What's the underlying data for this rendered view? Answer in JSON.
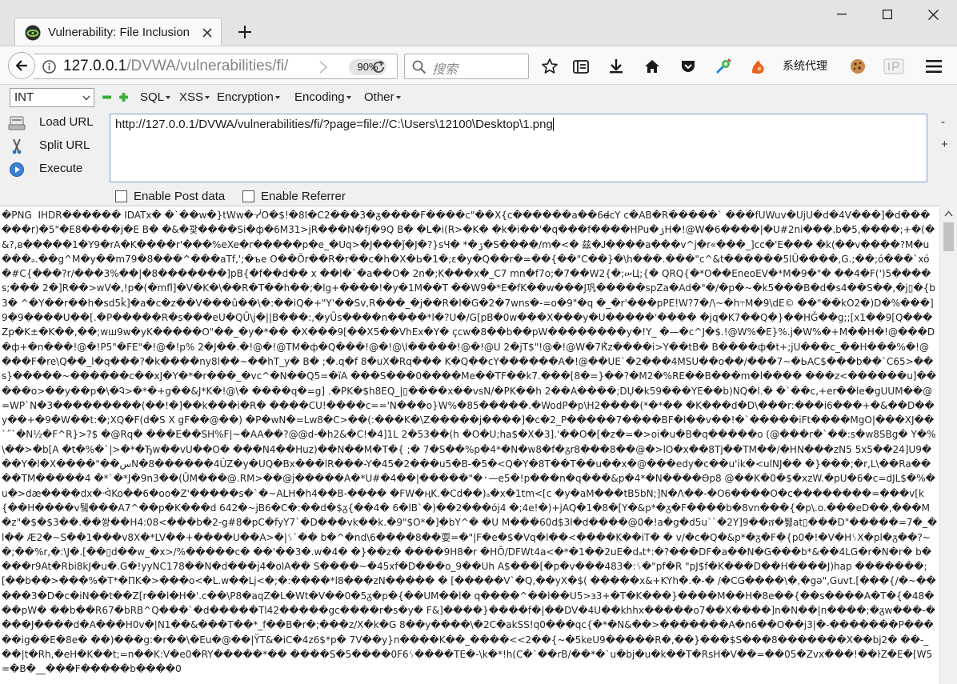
{
  "browser": {
    "tab_title": "Vulnerability: File Inclusion",
    "address": {
      "host": "127.0.0.1",
      "path": "/DVWA/vulnerabilities/fi/"
    },
    "zoom": "90%",
    "search_placeholder": "搜索",
    "proxy_label": "系统代理"
  },
  "hackbar": {
    "type_select": "INT",
    "menus": [
      "SQL",
      "XSS",
      "Encryption",
      "Encoding",
      "Other"
    ],
    "actions": {
      "load": "Load URL",
      "split": "Split URL",
      "execute": "Execute"
    },
    "url_value": "http://127.0.0.1/DVWA/vulnerabilities/fi/?page=file://C:\\Users\\12100\\Desktop\\1.png",
    "side_minus": "-",
    "side_plus": "+",
    "enable_post": "Enable Post data",
    "enable_referrer": "Enable Referrer"
  },
  "content": {
    "garbled_text": "�PNG  IHDR������ IDATx� �`��w�}tWw�ᓺO�$!�8I�C2���3�ᵹ����F����c\"��X{c������a��6d̶cY c�AB�R�����` ���fUWuv�UjU�d�4V���]�d������r)�5\"�E8����j�E B� �&�쾇����Si�ф�6M31>jR���N�fj�9Q B� �L�i(R>�K� �k�i��'�q���f����HPu�ۯH�!@W�6����|�U#2ni���.b�5,����;+�(�&?,в�����1�Y9�rA�K����r'���%eXe�r�����p�e_�Uq>�J���ǰ�J�?}sЧ� *�ۯ�S����/m�<� 兹�Ꭻ����a���v^j�r«���_]cc�'E��� �k(��v����?M�u���ₔ.��g^M�y��m79�8���^���aTf,';�ъe O��Õr��R�r��c�h�X�Ь�1�;ɛ�y�Q��r�=��{��\"C��}�\\h���.���\"c^&t������5lŪ����,G.;��;ó���`xó�#C{���?r/���3%��|�8�������]pB{�f��d�� x ��l�`�a��O� 2n�;K���x�_C7 mn�f7o;�7��W2{�;ሠЦ;{� QRQ{�*O��EneoEV�*M�9�\"� ��4�F(')5����s;��� 2�]R��>wV�,!p�(�mfl]�V�K�\\��R�T��h��;�lg+����!�y�1M��T ��W9�*E�fK��w���J巩�����spZa�Ad�\"�/�p�~�k5���B�d�s4��S��,�j▯�{b3� ^�Y��r��h�sd5k̃]�a�c�z��V���û��\\�:��iQ�+\"Y'��Sv,R���_�j��R�l�G�2�7wns�-=o�9\"�q �_�r'���pPE!W?7�/\\~�h⥾M�9\\dE© ��\"��kO2�)D�%���]9�9����U��[.�P�����R�s���eU�QŪ\\j�||B���:,�yŪs����n����*l�?U�/G[pB�0w���X���y�U�����'���� �jq�K7��Q�}��HǦ��g;;[x1��9[Q���Zp�K±�K��,��;wш9w�yK�����O\"��_�y�*�� �X���9[��X5��VhEx�Y� ҫcw�8��b��pW��������y�!Y_ �—�c^J�$.!@W%�E}%.j�W%�+M��H�!@���D�ф+�n���!@�!P5\"�FE\"�!@�!p% 2�J��.�!@�!@TM�ф�Q���!@�!@\\l�����!@�!@U 2�jT$\"!@�!@W�7Ќ̆z����i>Y��tB� B����ф�t+;jU���c_��H���%�!@���F�re\\Q��_l�q���?�k����ny8l��~��hT_y� B� ;�.q�f 8�uX�Rq��� K�Q��cY������A�!@��UE`�2���4MSU��o��/���7~�ЬAC$���b��`C65>��s}�����~������c��xJ�Y�*�r���_�vc^�N��Q5=�їA ���S���0����Me��TF��k7.���[8�=}��?�M2�%RE��B���m�l���� ���z<������u]�����o>��y��p�\\�Ꮈ>�*�+g��&J*K�!@\\� ����q�=g] .�PK�$h8EQ_|▯����x��vsN/�PK��h 2��A����;DỤ�k59���YE��b)NQ�l.� �`��c,+er��le�gUUM��@=WP`N�3���������(��!�]��k���i�R� ����CU!����c=='N���o}W%�85�����.�WodP�p\\H2����(*�*�� �K���d�D\\���r:���i6���+�&��D��y��+�9�W��t:�;XQ�F(d�S X gF��@��) �P�wN�=Lw8�C>��(:���K�\\Z�����j����]�c�2_P�����7����BF�l��v��!�`�����iFt����MgO|���XJ��`˝`�N½�F^R}>?$ �@Rq� ���E��SH%F|~�AA��?@@d-�h2&�C!�4]1L 2�53��(h �O�U;ha$�X�3].'��O�[�z�=�>oi�u�B�q�����o (@���r�`��:s�w8SBg� Y�%\\��>�b[A �t�%�`|>�*�Ђw��vU��O� ���N4��Huz)��N��M�T�{ ;� 7�S��%p�4*�N�w8�f�ᵹr8���8��@�>lO�x��8Tj��TM��/�HN���zN5 5x5��24]U9���Y�l�X����\"��ﺱN�8������4ÛZ�y�UQ�Bx���lR���-Y�45�2���u5�B-�5�<Q�Y�8T��T��u��x�@���edy�c��u'ik�<ulNJ�� �}���;�r,L\\��Ra����TM�����4 �*`�*J�9n3��(ŪM���@.RM>��@j�����A�*U#�4��|�����\"�᛫—e5�!p���n�q���&p�4*�N����Ѳp8 @��K�0�$�xzW.�pU�6�c=dJL$�%�u�>dӕ����dx�ᐙKo��6�oo�Z'�����s�`�~ALH�h4��B-���� �FW�ңK.�Cd��)ₐ�x�1tm<[c �y�aM���tB5bN;]N�ᐱ��-�O6����O�c��������=���v[k{��H����v퉼���A7^��p�K���d 642�~jB6�C�:��d�$ᵹ{��4� 6�lB`�)��2���ój4 �;4e!�)+jAQ�1�8�[Y�&p*�ᵹ�F����b�8vn���{�p\\.o.���eD��,���M�z\"�$�$3��.��쐉��H4:08<���b�2-g#8�pC�fyY7`�D���vk��k.�9\"$O*�]�bY^� �U M���60d$3l�d����@0�!a�g�d5u``�2Y]9��ሸ�퉳at▯���D\"�����=7�_�l�� Æ2�~S��1���v8X�*LV��+����U��A>�|ᛊ`�� b�^�nd\\6����8��耍=�\"|F�e�$�Vq�l��<����K��iT� � v/�c�Q�&p*�ᵹ�F�{p0�!�V�HᛊX�pl�ᵹ��?~�;��%r,�:\\J�.[��▯d��w_�x>/%�����c� ��'��3�.w�4� �}��z� ����9H8�r �HŌ/DFWt4a<�*�1��2uE�dₐt*:�?���DF�a��N�G���b*&��4LG�r�N�r� b����r9At�Rbi8kJ�u�.G�!yyNC178��N�d���j4�olA�� S����~�45xf�D���o_9��Uh A$���[�p�v���483�:ᛊ�\"pf�R \"pJ$f�K���D��H����J)hap �������;[��b��>���%�T*�ПK�>���o<�L.w��Lj<�;�:����*l8���zN����� � [�����V`�Q,��yX�$( �����x&+KYh�.�-� /�CG����\\�,�gә\",Guvt.[���{/�~�����3�D�c�iN��t��Z[r��l�H�'.c��\\P8�aqZ�L�Wt�V��0�5ᵹ�p�{��UM��l� q����^��l��U5>ɜ3+�T�K���}����M��H�8e��{��s����A�T�{�48���pW� ��b��R67�bRB^Q���`�d�����Tl42�����gc����r�s�y� F&]����}����f�|��DV�4U��khhx�����o7��X����]n�N��|n����;�ᵹw���-����J����d�A���H0v�|N1��&���T��*_f��B�r�;���z/X�k�G 8��y����\\�2C�akSS!q0���qc{�*�N&��>�������A�n6��O��j3|�-�������P�����ig��E�8e� ��)���g:�r��\\�Eu�@��|ŸT&�iC�4z6$*p� 7V��y}n����K��_����<<2��{~�5keU9�����R�,��}���$S���8�������X��bj2� ��-_��|t�Rh,�eH�K��t;=n��K:V�e0�RY�����*�� ����S�5����0F6ᛊ����TE�-\\k�*!h(C�`��rB/��*�`u�bj�u�k��T�RsH�V��=��05�Zvx���!��ŀZ�E�[W5=�B�__���F�����b����0"
  }
}
